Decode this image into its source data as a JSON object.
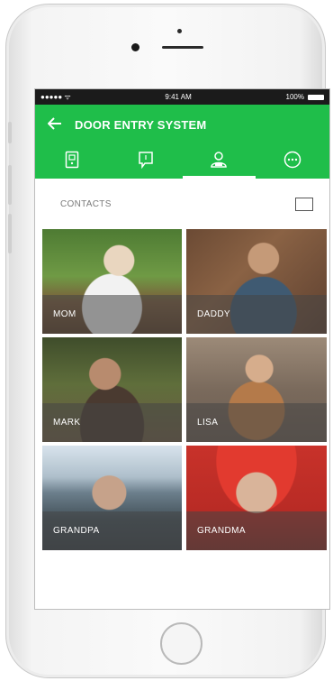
{
  "status_bar": {
    "signal": "●●●●● ᯤ",
    "time": "9:41 AM",
    "battery": "100%"
  },
  "app_bar": {
    "title": "DOOR ENTRY SYSTEM",
    "back_icon": "arrow-left-icon"
  },
  "tabs": [
    {
      "icon": "entry-panel-icon",
      "active": false
    },
    {
      "icon": "message-icon",
      "active": false
    },
    {
      "icon": "contacts-icon",
      "active": true
    },
    {
      "icon": "more-icon",
      "active": false
    }
  ],
  "section": {
    "label": "CONTACTS"
  },
  "contacts": [
    {
      "name": "MOM"
    },
    {
      "name": "DADDY"
    },
    {
      "name": "MARK"
    },
    {
      "name": "LISA"
    },
    {
      "name": "GRANDPA"
    },
    {
      "name": "GRANDMA"
    }
  ],
  "colors": {
    "accent": "#1fbe4a",
    "status_bar": "#1b1b1b"
  }
}
